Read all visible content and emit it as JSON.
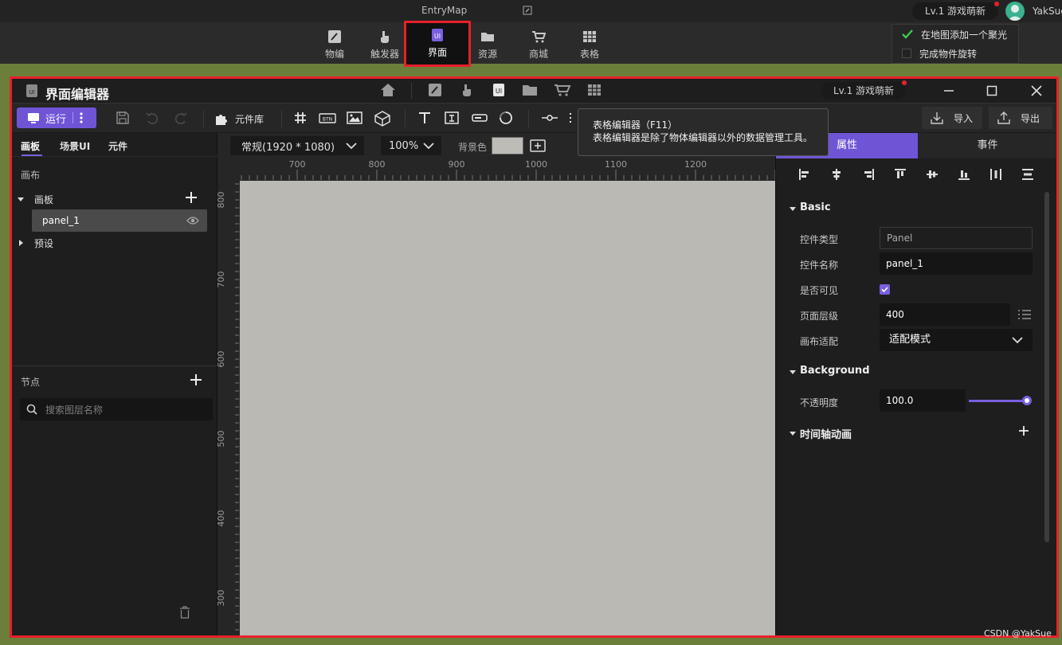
{
  "app": {
    "map_title": "EntryMap",
    "level_badge": "Lv.1 游戏萌新",
    "username": "YakSue",
    "watermark": "CSDN @YakSue"
  },
  "mode_tabs": [
    {
      "label": "物编",
      "icon": "brush-icon"
    },
    {
      "label": "触发器",
      "icon": "hand-pointer-icon"
    },
    {
      "label": "界面",
      "icon": "ui-icon",
      "active": true
    },
    {
      "label": "资源",
      "icon": "folder-icon"
    },
    {
      "label": "商城",
      "icon": "cart-icon"
    },
    {
      "label": "表格",
      "icon": "table-icon"
    }
  ],
  "checklist": [
    {
      "label": "在地图添加一个聚光",
      "checked": true
    },
    {
      "label": "完成物件旋转",
      "checked": false
    }
  ],
  "editor": {
    "title": "界面编辑器",
    "level_badge": "Lv.1 游戏萌新"
  },
  "toolbar": {
    "run_label": "运行",
    "component_lib_label": "元件库",
    "import_label": "导入",
    "export_label": "导出"
  },
  "tooltip": {
    "line1": "表格编辑器（F11）",
    "line2": "表格编辑器是除了物体编辑器以外的数据管理工具。"
  },
  "left_panel": {
    "tabs": [
      "画板",
      "场景UI",
      "元件"
    ],
    "canvas_section": "画布",
    "tree_root": "画板",
    "panel_item": "panel_1",
    "presets": "预设",
    "nodes_section": "节点",
    "search_placeholder": "搜索图层名称"
  },
  "canvas": {
    "resolution": "常规(1920 * 1080)",
    "zoom": "100%",
    "bg_label": "背景色",
    "bg_color": "#bab9b4",
    "ruler_h": [
      "700",
      "800",
      "900",
      "1000",
      "1100",
      "1200"
    ],
    "ruler_v": [
      "800",
      "700",
      "600",
      "500",
      "400",
      "300"
    ]
  },
  "right_panel": {
    "tabs": [
      "属性",
      "事件"
    ],
    "basic_section": "Basic",
    "props": {
      "type_label": "控件类型",
      "type_value": "Panel",
      "name_label": "控件名称",
      "name_value": "panel_1",
      "visible_label": "是否可见",
      "layer_label": "页面层级",
      "layer_value": "400",
      "adapt_label": "画布适配",
      "adapt_value": "适配模式"
    },
    "background_section": "Background",
    "opacity_label": "不透明度",
    "opacity_value": "100.0",
    "timeline_section": "时间轴动画"
  },
  "colors": {
    "accent": "#7054d6",
    "highlight": "#e8202a"
  }
}
